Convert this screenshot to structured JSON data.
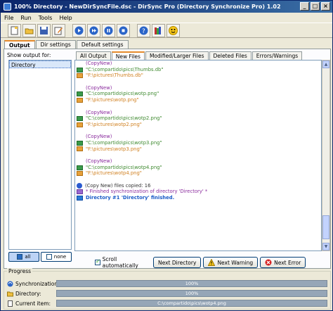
{
  "window": {
    "title": "100% Directory - NewDirSyncFile.dsc - DirSync Pro (Directory Synchronize Pro) 1.02",
    "controls": [
      "_",
      "□",
      "×"
    ]
  },
  "menu": [
    "File",
    "Run",
    "Tools",
    "Help"
  ],
  "toolbar": {
    "icons": [
      "new-file-icon",
      "open-folder-icon",
      "save-icon",
      "edit-icon",
      "play-analyze-icon",
      "play-sync-icon",
      "pause-icon",
      "stop-icon",
      "help-icon",
      "books-icon",
      "smiley-icon"
    ]
  },
  "main_tabs": [
    {
      "label": "Output",
      "active": true
    },
    {
      "label": "Dir settings",
      "active": false
    },
    {
      "label": "Default settings",
      "active": false
    }
  ],
  "output": {
    "show_label": "Show output for:",
    "list": [
      {
        "label": "Directory",
        "selected": true
      }
    ],
    "all_label": "all",
    "none_label": "none"
  },
  "sub_tabs": [
    {
      "label": "All Output",
      "active": false
    },
    {
      "label": "New Files",
      "active": true
    },
    {
      "label": "Modified/Larger Files",
      "active": false
    },
    {
      "label": "Deleted Files",
      "active": false
    },
    {
      "label": "Errors/Warnings",
      "active": false
    }
  ],
  "log": [
    {
      "icon": "",
      "text": "(CopyNew)",
      "cls": "purple"
    },
    {
      "icon": "green",
      "text": "\"C:\\compartido\\pics\\Thumbs.db\"",
      "cls": "green"
    },
    {
      "icon": "orange",
      "text": "\"F:\\pictures\\Thumbs.db\"",
      "cls": "orange"
    },
    {
      "icon": "",
      "text": "",
      "cls": ""
    },
    {
      "icon": "",
      "text": "(CopyNew)",
      "cls": "purple"
    },
    {
      "icon": "green",
      "text": "\"C:\\compartido\\pics\\wotp.png\"",
      "cls": "green"
    },
    {
      "icon": "orange",
      "text": "\"F:\\pictures\\wotp.png\"",
      "cls": "orange"
    },
    {
      "icon": "",
      "text": "",
      "cls": ""
    },
    {
      "icon": "",
      "text": "(CopyNew)",
      "cls": "purple"
    },
    {
      "icon": "green",
      "text": "\"C:\\compartido\\pics\\wotp2.png\"",
      "cls": "green"
    },
    {
      "icon": "orange",
      "text": "\"F:\\pictures\\wotp2.png\"",
      "cls": "orange"
    },
    {
      "icon": "",
      "text": "",
      "cls": ""
    },
    {
      "icon": "",
      "text": "(CopyNew)",
      "cls": "purple"
    },
    {
      "icon": "green",
      "text": "\"C:\\compartido\\pics\\wotp3.png\"",
      "cls": "green"
    },
    {
      "icon": "orange",
      "text": "\"F:\\pictures\\wotp3.png\"",
      "cls": "orange"
    },
    {
      "icon": "",
      "text": "",
      "cls": ""
    },
    {
      "icon": "",
      "text": "(CopyNew)",
      "cls": "purple"
    },
    {
      "icon": "green",
      "text": "\"C:\\compartido\\pics\\wotp4.png\"",
      "cls": "green"
    },
    {
      "icon": "orange",
      "text": "\"F:\\pictures\\wotp4.png\"",
      "cls": "orange"
    },
    {
      "icon": "",
      "text": "",
      "cls": ""
    },
    {
      "icon": "info",
      "text": "(Copy New) files copied: 16",
      "cls": "dark"
    },
    {
      "icon": "purple",
      "text": "* Finished synchronization of directory 'Directory' *",
      "cls": "purple"
    },
    {
      "icon": "flag",
      "text": "Directory #1 'Directory' finished.",
      "cls": "blue-bold"
    }
  ],
  "controls": {
    "auto_scroll_label": "Scroll automatically",
    "next_directory": "Next Directory",
    "next_warning": "Next Warning",
    "next_error": "Next Error"
  },
  "progress": {
    "title": "Progress",
    "rows": [
      {
        "label": "Synchronization:",
        "text": "100%",
        "fraction": 1.0
      },
      {
        "label": "Directory:",
        "text": "100%",
        "fraction": 1.0
      },
      {
        "label": "Current item:",
        "text": "C:\\compartido\\pics\\wotp4.png",
        "fraction": 1.0
      }
    ]
  }
}
